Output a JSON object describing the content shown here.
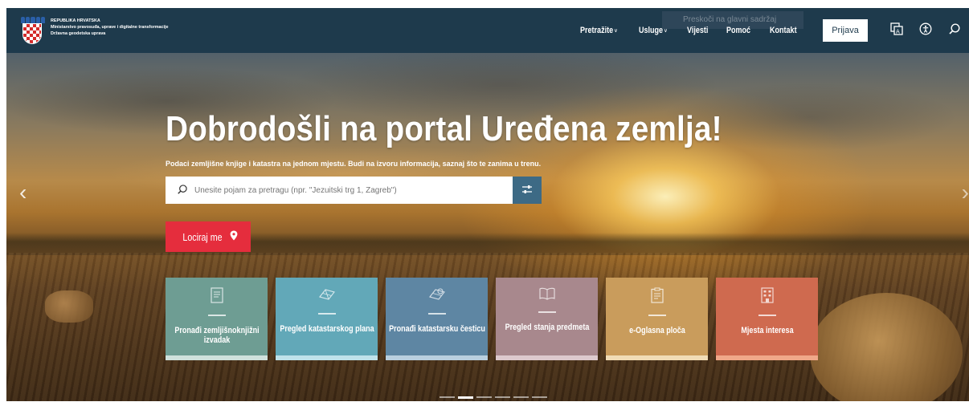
{
  "header": {
    "org_lines": [
      "REPUBLIKA HRVATSKA",
      "Ministarstvo pravosuđa, uprave i digitalne transformacije",
      "Državna geodetska uprava"
    ],
    "skip_link": "Preskoči na glavni sadržaj",
    "nav": [
      {
        "label": "Pretražite",
        "dropdown": true
      },
      {
        "label": "Usluge",
        "dropdown": true
      },
      {
        "label": "Vijesti",
        "dropdown": false
      },
      {
        "label": "Pomoć",
        "dropdown": false
      },
      {
        "label": "Kontakt",
        "dropdown": false
      }
    ],
    "login_label": "Prijava",
    "icons": [
      "language-icon",
      "accessibility-icon",
      "search-icon"
    ]
  },
  "hero": {
    "title": "Dobrodošli na portal Uređena zemlja!",
    "subtitle": "Podaci zemljišne knjige i katastra na jednom mjestu. Budi na izvoru informacija, saznaj što te zanima u trenu.",
    "search_placeholder": "Unesite pojam za pretragu (npr. \"Jezuitski trg 1, Zagreb\")",
    "locate_label": "Lociraj me"
  },
  "tiles": [
    {
      "label": "Pronađi zemljišnoknjižni izvadak",
      "icon": "document-icon",
      "color": "#6e9d93",
      "stripe": "#cfe1dc"
    },
    {
      "label": "Pregled katastarskog plana",
      "icon": "map-plan-icon",
      "color": "#62a8b8",
      "stripe": "#bfe2ea"
    },
    {
      "label": "Pronađi katastarsku česticu",
      "icon": "parcel-icon",
      "color": "#5e86a3",
      "stripe": "#b9cfdf"
    },
    {
      "label": "Pregled stanja predmeta",
      "icon": "book-icon",
      "color": "#a8888d",
      "stripe": "#ddc9cd"
    },
    {
      "label": "e-Oglasna ploča",
      "icon": "clipboard-icon",
      "color": "#c99c5c",
      "stripe": "#f1dcb6"
    },
    {
      "label": "Mjesta interesa",
      "icon": "building-icon",
      "color": "#cf6a4f",
      "stripe": "#f0a889"
    }
  ],
  "carousel": {
    "slides": 6,
    "active_index": 1
  }
}
